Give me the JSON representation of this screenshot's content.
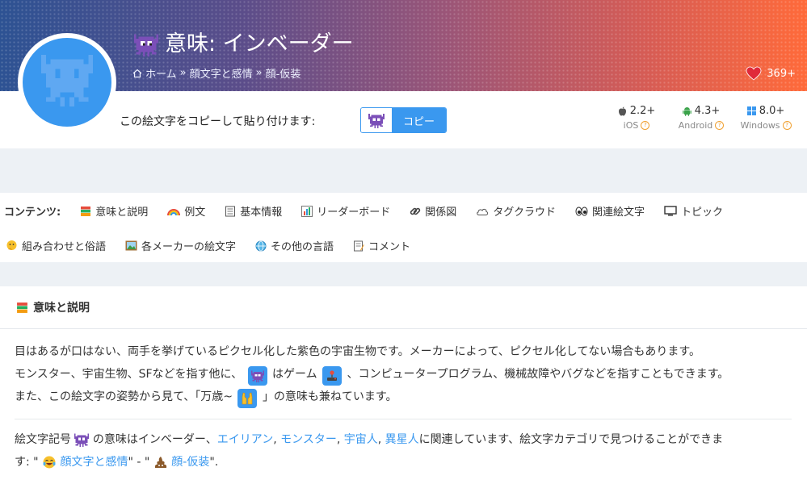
{
  "header": {
    "title": "意味: インベーダー",
    "breadcrumb": [
      "ホーム",
      "顔文字と感情",
      "顔-仮装"
    ],
    "breadcrumb_sep": "»",
    "likes": "369+"
  },
  "copy": {
    "label": "この絵文字をコピーして貼り付けます:",
    "button": "コピー"
  },
  "platforms": [
    {
      "version": "2.2+",
      "name": "iOS"
    },
    {
      "version": "4.3+",
      "name": "Android"
    },
    {
      "version": "8.0+",
      "name": "Windows"
    }
  ],
  "nav": {
    "heading": "コンテンツ:",
    "items": [
      {
        "label": "意味と説明",
        "icon": "books-icon"
      },
      {
        "label": "例文",
        "icon": "rainbow-icon"
      },
      {
        "label": "基本情報",
        "icon": "notepad-icon"
      },
      {
        "label": "リーダーボード",
        "icon": "bar-chart-icon"
      },
      {
        "label": "関係図",
        "icon": "link-icon"
      },
      {
        "label": "タグクラウド",
        "icon": "cloud-icon"
      },
      {
        "label": "関連絵文字",
        "icon": "eyes-icon"
      },
      {
        "label": "トピック",
        "icon": "monitor-icon"
      },
      {
        "label": "組み合わせと俗語",
        "icon": "thinking-face-icon"
      },
      {
        "label": "各メーカーの絵文字",
        "icon": "framed-picture-icon"
      },
      {
        "label": "その他の言語",
        "icon": "globe-icon"
      },
      {
        "label": "コメント",
        "icon": "memo-icon"
      }
    ]
  },
  "section": {
    "title": "意味と説明",
    "p1": {
      "line1": "目はあるが口はない、両手を挙げているピクセル化した紫色の宇宙生物です。メーカーによって、ピクセル化してない場合もあります。",
      "line2a": "モンスター、宇宙生物、SFなどを指す他に、",
      "line2b": "はゲーム",
      "line2c": "、コンピュータープログラム、機械故障やバグなどを指すこともできます。",
      "line3a": "また、この絵文字の姿勢から見て、「万歳~",
      "line3b": "」の意味も兼ねています。"
    },
    "p2": {
      "prefix": "絵文字記号",
      "mid": "の意味はインベーダー、",
      "links": [
        "エイリアン",
        "モンスター",
        "宇宙人",
        "異星人"
      ],
      "sep": ",",
      "after": "に関連しています、絵文字カテゴリで見つけることができま",
      "line2a": "す: \"",
      "cat1": "顔文字と感情",
      "dash": "\" - \"",
      "cat2": "顔-仮装",
      "end": "\"."
    }
  },
  "colors": {
    "accent": "#3a98ef",
    "gray_band": "#edf1f5",
    "heart": "#e02a3a"
  }
}
